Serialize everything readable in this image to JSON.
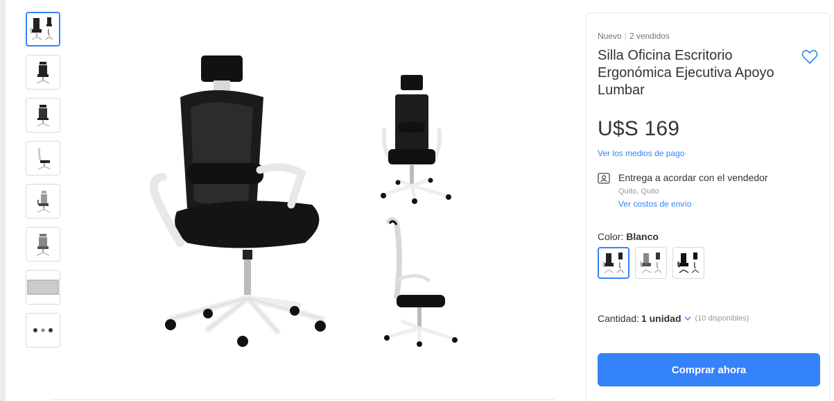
{
  "thumbnails": [
    {
      "name": "thumb-1",
      "selected": true
    },
    {
      "name": "thumb-2",
      "selected": false
    },
    {
      "name": "thumb-3",
      "selected": false
    },
    {
      "name": "thumb-4",
      "selected": false
    },
    {
      "name": "thumb-5",
      "selected": false
    },
    {
      "name": "thumb-6",
      "selected": false
    },
    {
      "name": "thumb-7",
      "selected": false
    },
    {
      "name": "thumb-8",
      "selected": false
    }
  ],
  "product": {
    "condition": "Nuevo",
    "separator": "|",
    "sold": "2 vendidos",
    "title": "Silla Oficina Escritorio Ergonómica Ejecutiva Apoyo Lumbar",
    "price": "U$S 169",
    "payment_link": "Ver los medios de pago"
  },
  "delivery": {
    "icon": "seller-delivery-icon",
    "text": "Entrega a acordar con el vendedor",
    "location": "Quito, Quito",
    "shipping_link": "Ver costos de envío"
  },
  "color": {
    "label": "Color: ",
    "value": "Blanco",
    "variant_count": 3
  },
  "quantity": {
    "label": "Cantidad:",
    "value": "1 unidad",
    "available": "(10 disponibles)"
  },
  "buy_button": "Comprar ahora",
  "colors": {
    "accent": "#3483fa",
    "text": "#333333",
    "muted": "#999999"
  }
}
